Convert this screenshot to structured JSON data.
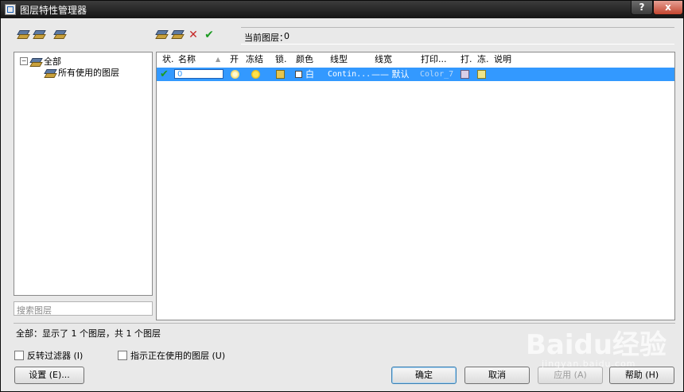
{
  "window": {
    "title": "图层特性管理器",
    "help_glyph": "?",
    "close_glyph": "x"
  },
  "toolbar": {
    "left_icons": [
      "new-property-filter-icon",
      "new-group-filter-icon",
      "layer-states-manager-icon"
    ],
    "right_icons": [
      "new-layer-icon",
      "new-layer-vp-frozen-icon",
      "delete-layer-icon",
      "set-current-icon"
    ],
    "delete_glyph": "✕",
    "current_glyph": "✔"
  },
  "current_layer": {
    "label": "当前图层：",
    "value": "0"
  },
  "tree": {
    "root_label": "全部",
    "child_label": "所有使用的图层",
    "expander": "−"
  },
  "search": {
    "placeholder": "搜索图层"
  },
  "table": {
    "columns": [
      "状.",
      "名称",
      "开",
      "冻结",
      "锁.",
      "颜色",
      "线型",
      "线宽",
      "打印...",
      "打.",
      "冻.",
      "说明"
    ],
    "sort_indicator": "▲",
    "row": {
      "status_glyph": "✔",
      "name": "0",
      "color_name": "白",
      "linetype": "Contin...",
      "lineweight": "—— 默认",
      "plot_style": "Color_7"
    }
  },
  "footer": {
    "summary": "全部：显示了 1 个图层，共 1 个图层",
    "invert_filter": "反转过滤器 (I)",
    "indicate_in_use": "指示正在使用的图层 (U)"
  },
  "buttons": {
    "settings": "设置 (E)...",
    "ok": "确定",
    "cancel": "取消",
    "apply": "应用 (A)",
    "help": "帮助 (H)"
  },
  "watermark": {
    "brand": "Baidu经验",
    "url": "jingyan.baidu.com"
  },
  "colors": {
    "selection": "#3399ff",
    "titlebar": "#1e1e1e",
    "close": "#c3452f"
  }
}
